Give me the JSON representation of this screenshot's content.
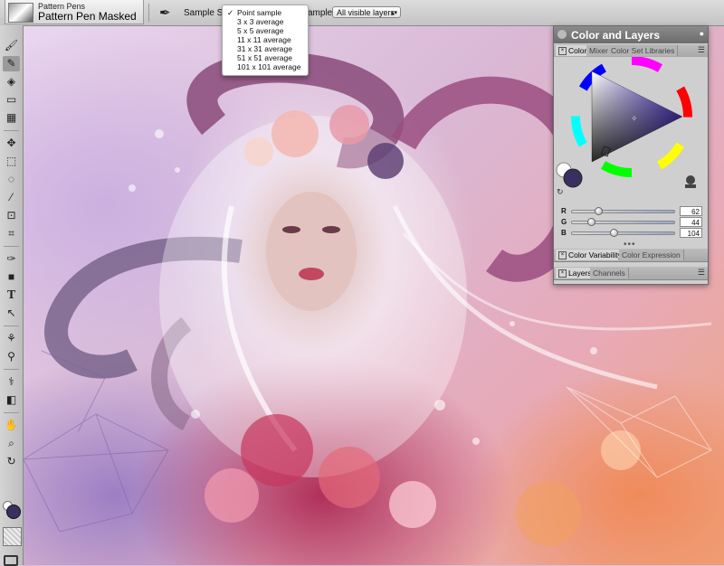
{
  "toolbar": {
    "brush_category": "Pattern Pens",
    "brush_variant": "Pattern Pen Masked",
    "sample_size_label": "Sample Size",
    "sample_label": "ample:",
    "sample_layers_value": "All visible layers"
  },
  "sample_size_menu": {
    "items": [
      {
        "label": "Point sample",
        "checked": true
      },
      {
        "label": "3 x 3 average",
        "checked": false
      },
      {
        "label": "5 x 5 average",
        "checked": false
      },
      {
        "label": "11 x 11 average",
        "checked": false
      },
      {
        "label": "31 x 31 average",
        "checked": false
      },
      {
        "label": "51 x 51 average",
        "checked": false
      },
      {
        "label": "101 x 101 average",
        "checked": false
      }
    ],
    "check_mark": "✓"
  },
  "toolbox": {
    "tools": [
      "brush-icon",
      "dropper-icon",
      "paint-bucket-icon",
      "eraser-icon",
      "stamp-icon",
      "move-icon",
      "rect-select-icon",
      "lasso-icon",
      "magic-wand-icon",
      "transform-icon",
      "crop-icon",
      "pen-icon",
      "shape-icon",
      "text-icon",
      "selection-arrow-icon",
      "cloner-icon",
      "blender-icon",
      "dodge-icon",
      "rubber-stamp-icon",
      "grabber-icon",
      "magnifier-icon",
      "rotate-page-icon"
    ]
  },
  "colors": {
    "main_color": "#3a3060",
    "panel_header": "#777777"
  },
  "color_panel": {
    "title": "Color and Layers",
    "tabs": [
      "Color",
      "Mixer",
      "Color Set Libraries"
    ],
    "rgb": [
      {
        "label": "R",
        "value": "62",
        "fraction": 0.243
      },
      {
        "label": "G",
        "value": "44",
        "fraction": 0.173
      },
      {
        "label": "B",
        "value": "104",
        "fraction": 0.408
      }
    ],
    "variability_tabs": [
      "Color Variability",
      "Color Expression"
    ],
    "layer_tabs": [
      "Layers",
      "Channels"
    ]
  }
}
